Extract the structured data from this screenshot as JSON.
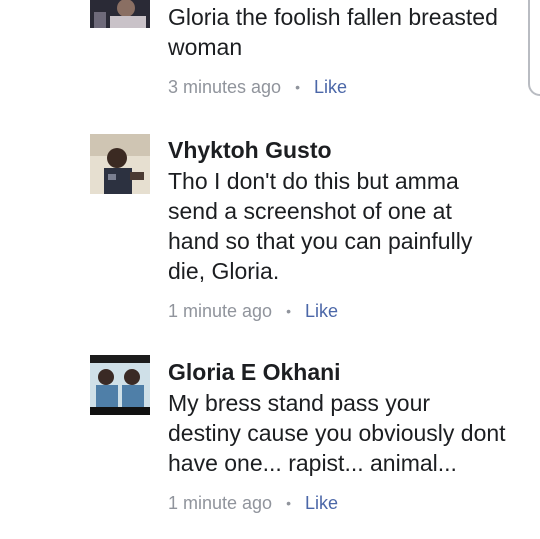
{
  "comments": [
    {
      "author": "",
      "text": "Gloria the foolish fallen breasted\nwoman",
      "time": "3 minutes ago",
      "like_label": "Like"
    },
    {
      "author": "Vhyktoh Gusto",
      "text": "Tho I don't do this but amma\nsend a screenshot of one at\nhand so that you can painfully\ndie, Gloria.",
      "time": "1 minute ago",
      "like_label": "Like"
    },
    {
      "author": "Gloria E Okhani",
      "text": "My bress stand pass your\ndestiny cause you obviously dont\nhave one... rapist... animal...",
      "time": "1 minute ago",
      "like_label": "Like"
    }
  ],
  "separator": "•",
  "colors": {
    "text": "#1c1e21",
    "meta": "#90949c",
    "like": "#4b67a8"
  }
}
